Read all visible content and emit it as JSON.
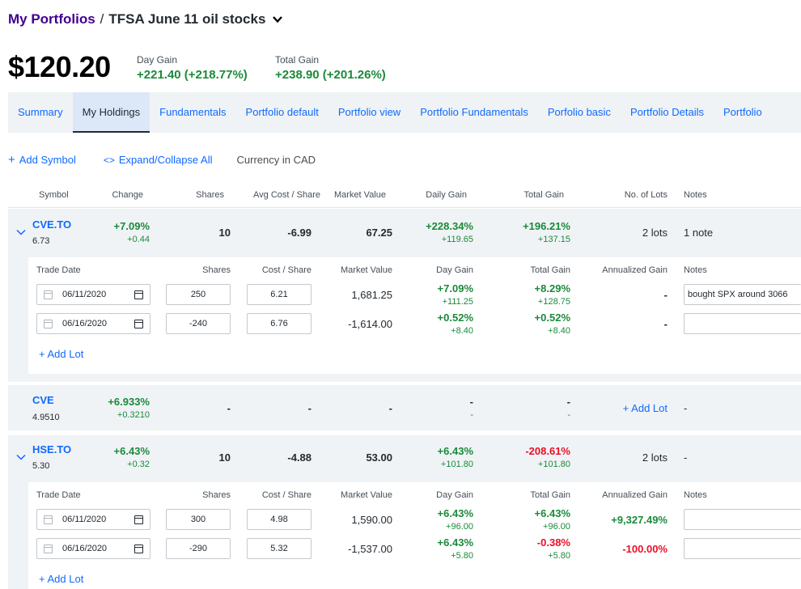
{
  "breadcrumb": {
    "parent": "My Portfolios",
    "separator": "/",
    "current": "TFSA June 11 oil stocks"
  },
  "summary": {
    "value": "$120.20",
    "day_gain_label": "Day Gain",
    "day_gain_value": "+221.40 (+218.77%)",
    "total_gain_label": "Total Gain",
    "total_gain_value": "+238.90 (+201.26%)"
  },
  "tabs": [
    "Summary",
    "My Holdings",
    "Fundamentals",
    "Portfolio default",
    "Portfolio view",
    "Portfolio Fundamentals",
    "Porfolio basic",
    "Portfolio Details",
    "Portfolio"
  ],
  "toolbar": {
    "add_symbol": "Add Symbol",
    "expand_collapse": "Expand/Collapse All",
    "currency": "Currency in CAD"
  },
  "columns": [
    "Symbol",
    "Change",
    "Shares",
    "Avg Cost / Share",
    "Market Value",
    "Daily Gain",
    "Total Gain",
    "No. of Lots",
    "Notes"
  ],
  "lot_columns": [
    "Trade Date",
    "Shares",
    "Cost / Share",
    "Market Value",
    "Day Gain",
    "Total Gain",
    "Annualized Gain",
    "Notes"
  ],
  "holdings": [
    {
      "symbol": "CVE.TO",
      "price": "6.73",
      "change_pct": "+7.09%",
      "change": "+0.44",
      "shares": "10",
      "avg_cost": "-6.99",
      "market_value": "67.25",
      "daily_gain_pct": "+228.34%",
      "daily_gain": "+119.65",
      "total_gain_pct": "+196.21%",
      "total_gain": "+137.15",
      "lots": "2 lots",
      "notes": "1 note",
      "lot_rows": [
        {
          "date": "06/11/2020",
          "shares": "250",
          "cost": "6.21",
          "market_value": "1,681.25",
          "day_gain_pct": "+7.09%",
          "day_gain": "+111.25",
          "total_gain_pct": "+8.29%",
          "total_gain": "+128.75",
          "annualized": "-",
          "note": "bought SPX around 3066"
        },
        {
          "date": "06/16/2020",
          "shares": "-240",
          "cost": "6.76",
          "market_value": "-1,614.00",
          "day_gain_pct": "+0.52%",
          "day_gain": "+8.40",
          "total_gain_pct": "+0.52%",
          "total_gain": "+8.40",
          "annualized": "-",
          "note": ""
        }
      ],
      "add_lot": "Add Lot"
    },
    {
      "symbol": "CVE",
      "price": "4.9510",
      "change_pct": "+6.933%",
      "change": "+0.3210",
      "shares": "-",
      "avg_cost": "-",
      "market_value": "-",
      "daily_gain_pct": "-",
      "daily_gain": "-",
      "total_gain_pct": "-",
      "total_gain": "-",
      "lots": "Add Lot",
      "notes": "-"
    },
    {
      "symbol": "HSE.TO",
      "price": "5.30",
      "change_pct": "+6.43%",
      "change": "+0.32",
      "shares": "10",
      "avg_cost": "-4.88",
      "market_value": "53.00",
      "daily_gain_pct": "+6.43%",
      "daily_gain": "+101.80",
      "total_gain_pct": "-208.61%",
      "total_gain": "+101.80",
      "lots": "2 lots",
      "notes": "-",
      "lot_rows": [
        {
          "date": "06/11/2020",
          "shares": "300",
          "cost": "4.98",
          "market_value": "1,590.00",
          "day_gain_pct": "+6.43%",
          "day_gain": "+96.00",
          "total_gain_pct": "+6.43%",
          "total_gain": "+96.00",
          "annualized": "+9,327.49%",
          "note": ""
        },
        {
          "date": "06/16/2020",
          "shares": "-290",
          "cost": "5.32",
          "market_value": "-1,537.00",
          "day_gain_pct": "+6.43%",
          "day_gain": "+5.80",
          "total_gain_pct": "-0.38%",
          "total_gain": "+5.80",
          "annualized": "-100.00%",
          "note": ""
        }
      ],
      "add_lot": "Add Lot"
    }
  ]
}
